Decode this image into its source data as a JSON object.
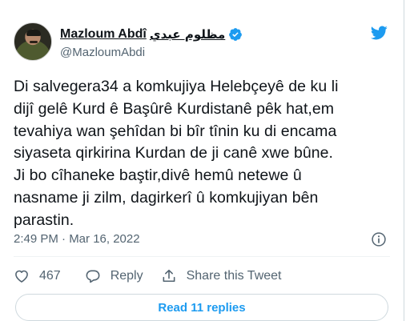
{
  "author": {
    "name": "Mazloum Abdî",
    "name_arabic": "مظلوم عبدي",
    "handle": "@MazloumAbdi",
    "verified": true
  },
  "tweet": {
    "text": "Di salvegera34 a komkujiya Helebçeyê de ku li\ndijî gelê Kurd ê Başûrê Kurdistanê pêk hat,em\ntevahiya wan şehîdan bi bîr tînin ku di encama\nsiyaseta qirkirina Kurdan de ji canê xwe bûne.\nJi bo cîhaneke baştir,divê hemû netewe û\nnasname ji zilm, dagirkerî û komkujiyan bên\nparastin.",
    "timestamp": "2:49 PM · Mar 16, 2022"
  },
  "actions": {
    "like_count": "467",
    "reply_label": "Reply",
    "share_label": "Share this Tweet"
  },
  "footer": {
    "read_replies_label": "Read 11 replies"
  },
  "colors": {
    "accent": "#1d9bf0",
    "text": "#0f1419",
    "secondary": "#536471"
  },
  "icons": {
    "brand": "twitter-bird-icon",
    "verified": "verified-badge-icon",
    "info": "info-icon",
    "like": "heart-icon",
    "reply": "reply-bubble-icon",
    "share": "share-icon"
  }
}
